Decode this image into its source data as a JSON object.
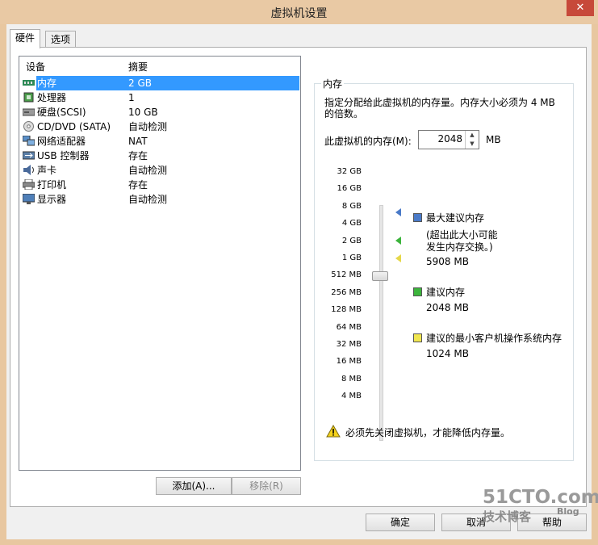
{
  "window": {
    "title": "虚拟机设置",
    "close_glyph": "✕"
  },
  "tabs": [
    {
      "label": "硬件",
      "active": true
    },
    {
      "label": "选项",
      "active": false
    }
  ],
  "device_list": {
    "header_device": "设备",
    "header_summary": "摘要",
    "rows": [
      {
        "device": "内存",
        "summary": "2 GB",
        "icon": "memory-icon",
        "selected": true
      },
      {
        "device": "处理器",
        "summary": "1",
        "icon": "cpu-icon"
      },
      {
        "device": "硬盘(SCSI)",
        "summary": "10 GB",
        "icon": "hard-disk-icon"
      },
      {
        "device": "CD/DVD (SATA)",
        "summary": "自动检测",
        "icon": "cd-dvd-icon"
      },
      {
        "device": "网络适配器",
        "summary": "NAT",
        "icon": "network-adapter-icon"
      },
      {
        "device": "USB 控制器",
        "summary": "存在",
        "icon": "usb-icon"
      },
      {
        "device": "声卡",
        "summary": "自动检测",
        "icon": "sound-card-icon"
      },
      {
        "device": "打印机",
        "summary": "存在",
        "icon": "printer-icon"
      },
      {
        "device": "显示器",
        "summary": "自动检测",
        "icon": "display-icon"
      }
    ],
    "add_button": "添加(A)...",
    "remove_button": "移除(R)"
  },
  "memory": {
    "group_title": "内存",
    "description": "指定分配给此虚拟机的内存量。内存大小必须为 4 MB 的倍数。",
    "memory_label": "此虚拟机的内存(M):",
    "memory_value": "2048",
    "unit": "MB",
    "scale": [
      "32 GB",
      "16 GB",
      "8 GB",
      "4 GB",
      "2 GB",
      "1 GB",
      "512 MB",
      "256 MB",
      "128 MB",
      "64 MB",
      "32 MB",
      "16 MB",
      "8 MB",
      "4 MB"
    ],
    "slider_value": "2 GB",
    "max_recommended": {
      "title": "最大建议内存",
      "note1": "(超出此大小可能",
      "note2": "发生内存交换。)",
      "value": "5908 MB",
      "color": "#4a7ac8"
    },
    "recommended": {
      "title": "建议内存",
      "value": "2048 MB",
      "color": "#3cb43c"
    },
    "min_guest": {
      "title": "建议的最小客户机操作系统内存",
      "value": "1024 MB",
      "color": "#f0e650"
    },
    "warning": "必须先关闭虚拟机，才能降低内存量。"
  },
  "footer": {
    "ok": "确定",
    "cancel": "取消",
    "help": "帮助"
  },
  "watermark": {
    "site": "51CTO.com",
    "sub": "技术博客",
    "blog": "Blog"
  }
}
